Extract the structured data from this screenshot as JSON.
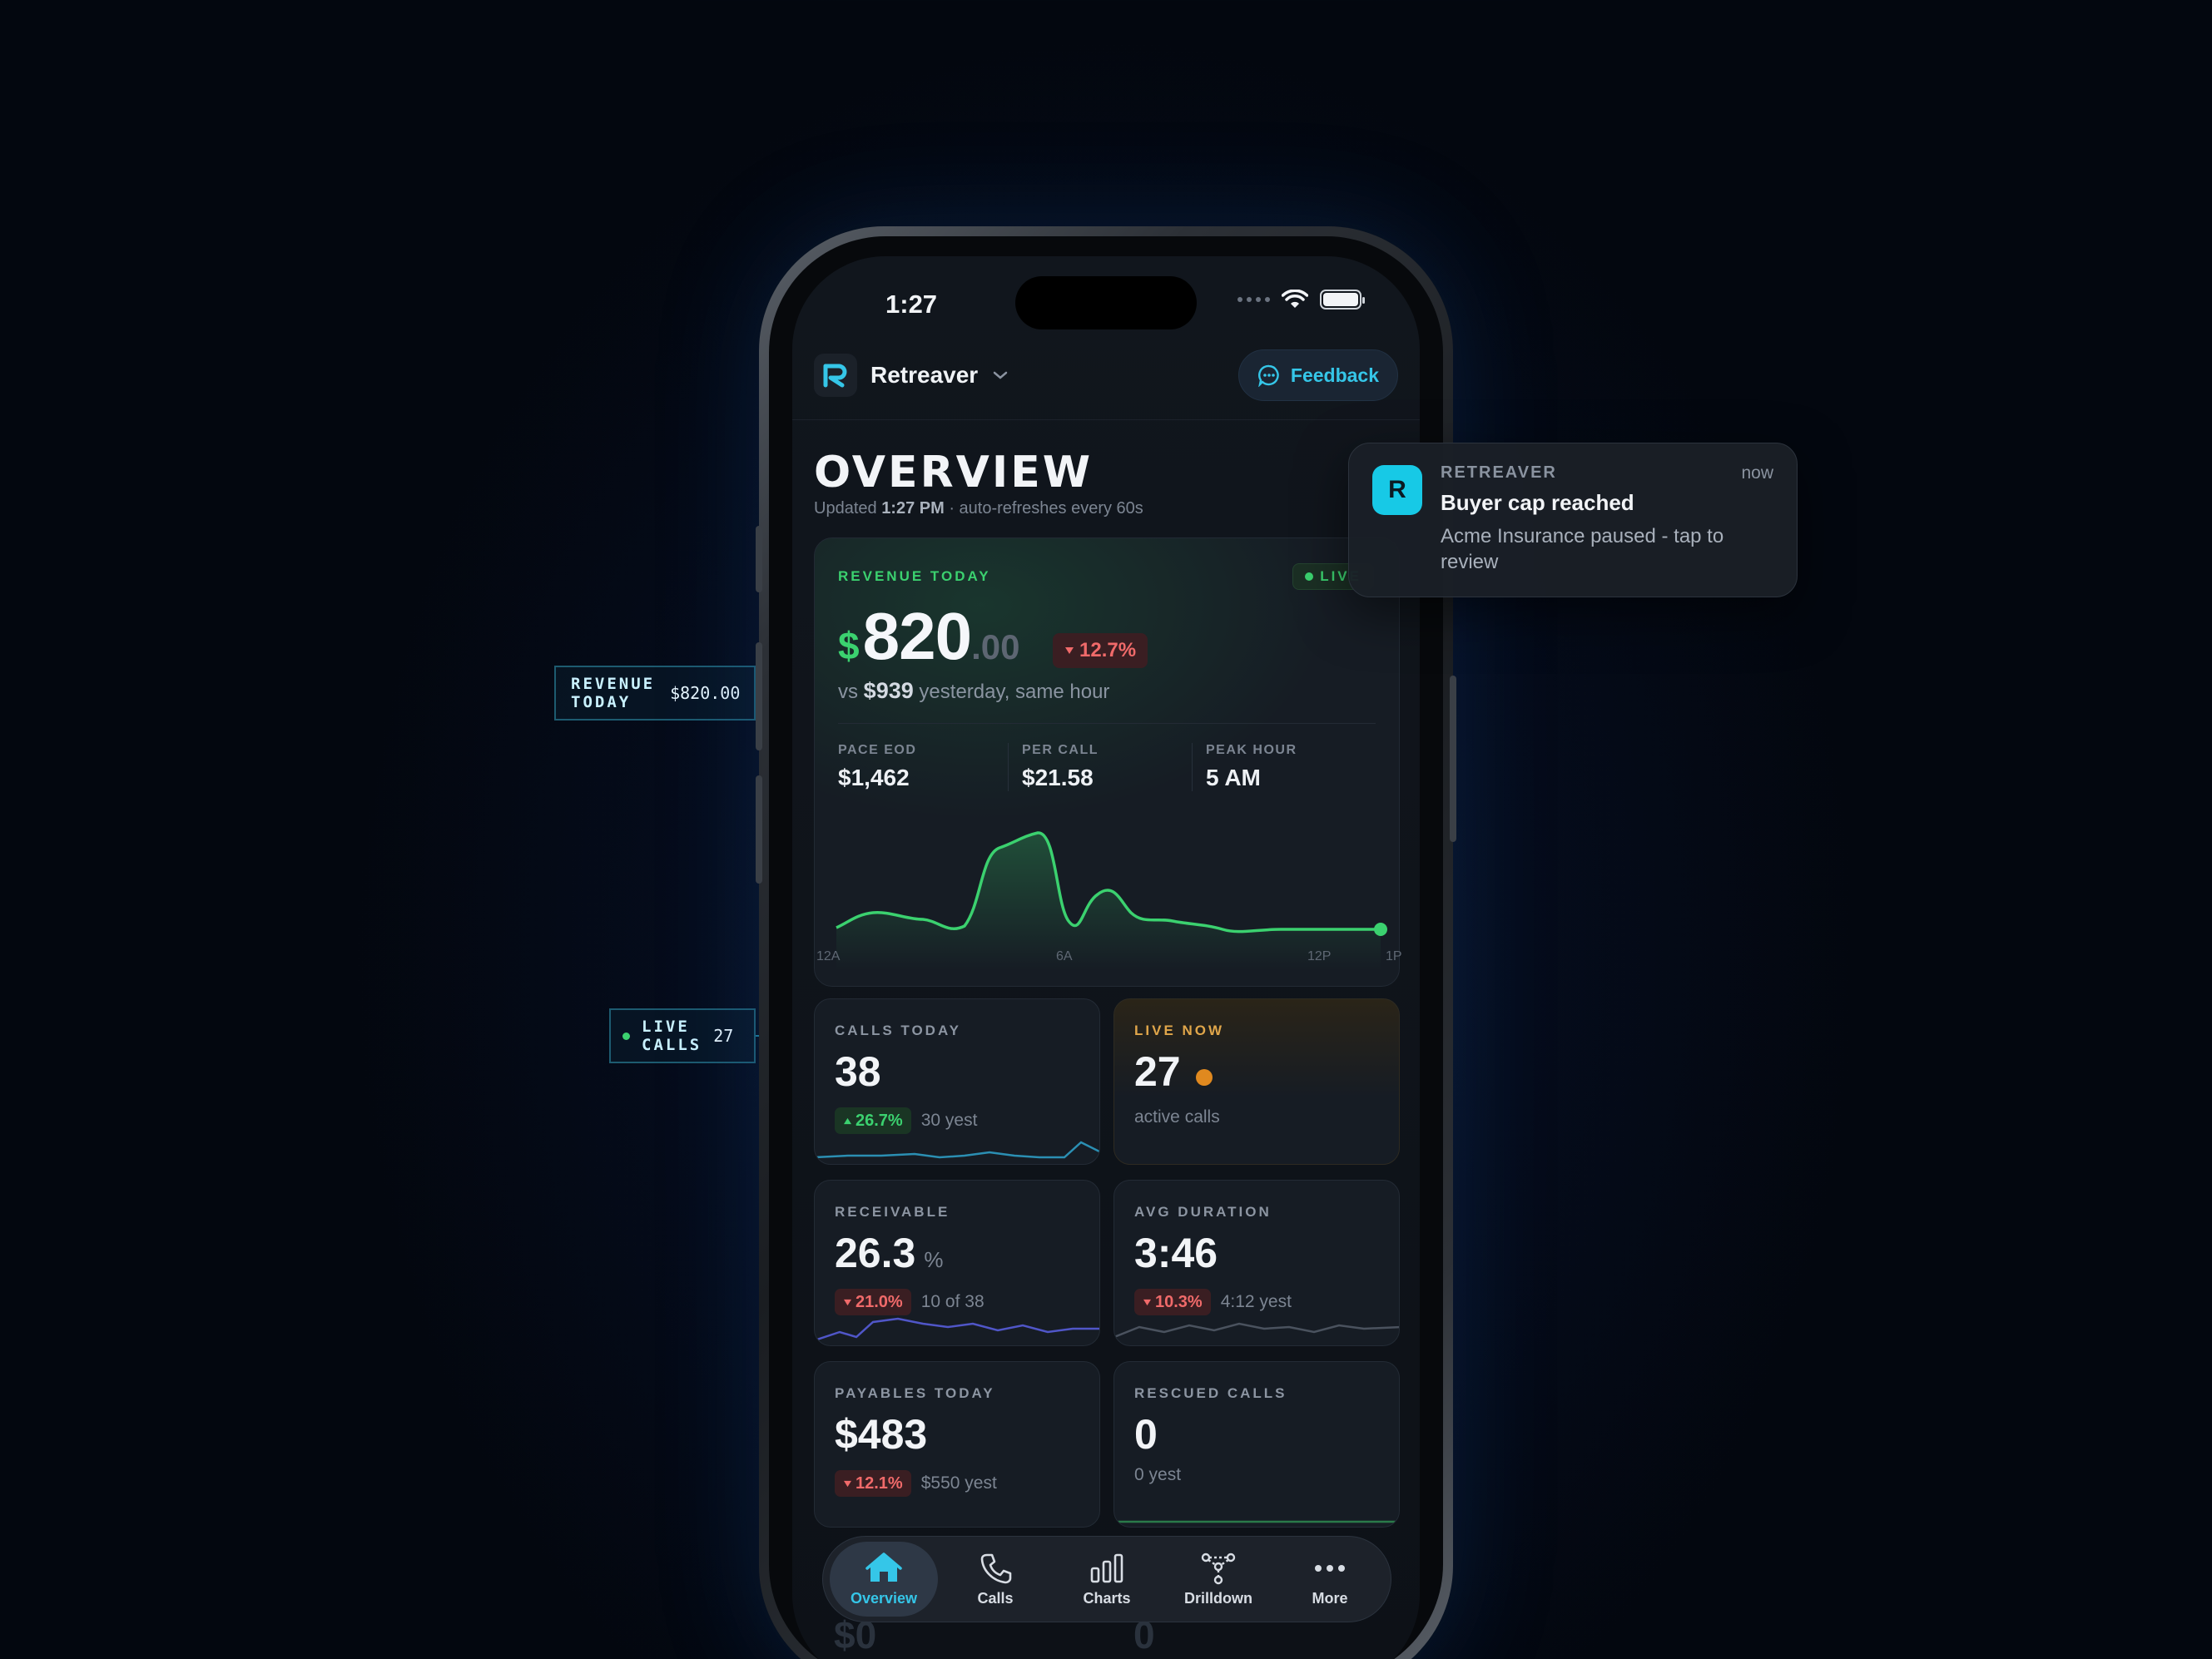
{
  "status_bar": {
    "time": "1:27"
  },
  "header": {
    "brand": "Retreaver",
    "feedback_label": "Feedback"
  },
  "overview": {
    "title": "OVERVIEW",
    "updated_prefix": "Updated",
    "updated_time": "1:27 PM",
    "updated_suffix": "· auto-refreshes every 60s"
  },
  "revenue": {
    "label": "REVENUE TODAY",
    "live_label": "LIVE",
    "currency": "$",
    "amount_main": "820",
    "amount_cents": ".00",
    "delta": "12.7%",
    "vs_prefix": "vs",
    "vs_amount": "$939",
    "vs_suffix": "yesterday, same hour",
    "stats": [
      {
        "label": "PACE EOD",
        "value": "$1,462"
      },
      {
        "label": "PER CALL",
        "value": "$21.58"
      },
      {
        "label": "PEAK HOUR",
        "value": "5 AM"
      }
    ],
    "chart_axis": [
      "12A",
      "6A",
      "12P",
      "1P"
    ]
  },
  "tiles": {
    "calls_today": {
      "label": "CALLS TODAY",
      "value": "38",
      "delta": "26.7%",
      "foot": "30 yest"
    },
    "live_now": {
      "label": "LIVE NOW",
      "value": "27",
      "foot": "active calls"
    },
    "receivable": {
      "label": "RECEIVABLE",
      "value": "26.3",
      "unit": "%",
      "delta": "21.0%",
      "foot": "10 of 38"
    },
    "avg_duration": {
      "label": "AVG DURATION",
      "value": "3:46",
      "delta": "10.3%",
      "foot": "4:12 yest"
    },
    "payables": {
      "label": "PAYABLES TODAY",
      "value": "$483",
      "delta": "12.1%",
      "foot": "$550 yest"
    },
    "rescued": {
      "label": "RESCUED CALLS",
      "value": "0",
      "foot": "0 yest"
    }
  },
  "peek": {
    "left": "$0",
    "right": "0"
  },
  "tabbar": {
    "items": [
      {
        "label": "Overview",
        "icon": "home-icon"
      },
      {
        "label": "Calls",
        "icon": "phone-icon"
      },
      {
        "label": "Charts",
        "icon": "bar-chart-icon"
      },
      {
        "label": "Drilldown",
        "icon": "drilldown-icon"
      },
      {
        "label": "More",
        "icon": "more-icon"
      }
    ]
  },
  "notification": {
    "app": "RETREAVER",
    "icon_letter": "R",
    "time": "now",
    "title": "Buyer cap reached",
    "body": "Acme Insurance paused - tap to review"
  },
  "callouts": {
    "revenue": {
      "label_line1": "REVENUE",
      "label_line2": "TODAY",
      "value": "$820.00"
    },
    "live_calls": {
      "label_line1": "LIVE",
      "label_line2": "CALLS",
      "value": "27"
    }
  },
  "colors": {
    "accent": "#35c6e8",
    "positive": "#3bd16f",
    "negative": "#f06a6a",
    "warning": "#e0891f"
  }
}
